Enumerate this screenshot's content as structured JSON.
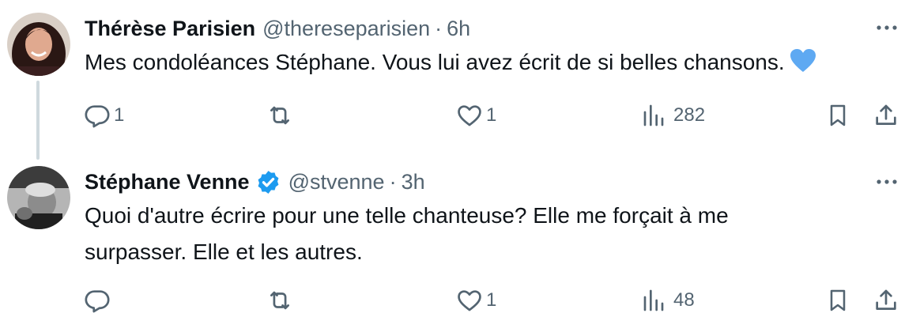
{
  "tweets": [
    {
      "name": "Thérèse Parisien",
      "handle": "@thereseparisien",
      "separator": "·",
      "time": "6h",
      "verified": false,
      "text": "Mes condoléances Stéphane. Vous lui avez écrit de si belles chansons.",
      "emoji": "blue-heart-emoji",
      "stats": {
        "replies": "1",
        "retweets": "",
        "likes": "1",
        "views": "282"
      }
    },
    {
      "name": "Stéphane Venne",
      "handle": "@stvenne",
      "separator": "·",
      "time": "3h",
      "verified": true,
      "text": "Quoi d'autre écrire pour une telle chanteuse? Elle me forçait à me surpasser. Elle et les autres.",
      "stats": {
        "replies": "",
        "retweets": "",
        "likes": "1",
        "views": "48"
      }
    }
  ],
  "colors": {
    "text": "#0f1419",
    "secondary": "#536471",
    "verified": "#1d9bf0",
    "heart": "#5ea9f2",
    "thread_line": "#cfd9de"
  },
  "icons": [
    "reply-icon",
    "retweet-icon",
    "like-icon",
    "views-icon",
    "bookmark-icon",
    "share-icon",
    "more-icon",
    "verified-badge-icon"
  ]
}
